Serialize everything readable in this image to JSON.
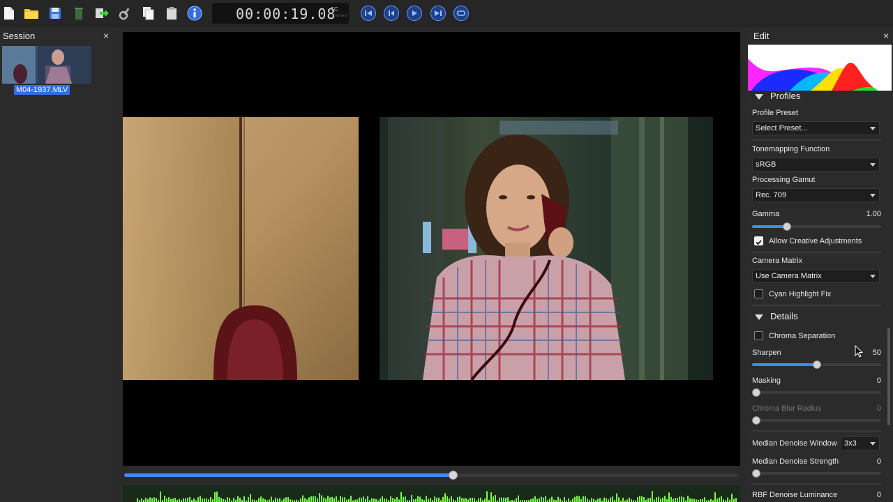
{
  "app": {
    "timecode": "00:00:19.08",
    "tc_label": "TC",
    "tc_sub": "(frames)"
  },
  "toolbar": {
    "icons": [
      "new-file-icon",
      "open-folder-icon",
      "save-icon",
      "trash-icon",
      "export-icon",
      "settings-icon",
      "copy-icon",
      "paste-icon",
      "info-icon"
    ],
    "nav_buttons": [
      "jump-start-icon",
      "step-back-icon",
      "play-icon",
      "jump-end-icon",
      "loop-icon"
    ]
  },
  "session": {
    "title": "Session",
    "close": "×",
    "clip_name": "M04-1937.MLV"
  },
  "viewer": {
    "playback_progress": 0.535
  },
  "edit": {
    "title": "Edit",
    "close": "×",
    "sections": {
      "profiles": "Profiles",
      "details": "Details"
    },
    "profile_preset": {
      "label": "Profile Preset",
      "value": "Select Preset..."
    },
    "tonemapping": {
      "label": "Tonemapping Function",
      "value": "sRGB"
    },
    "gamut": {
      "label": "Processing Gamut",
      "value": "Rec. 709"
    },
    "gamma": {
      "label": "Gamma",
      "value": "1.00",
      "fraction": 0.27
    },
    "allow_creative": {
      "label": "Allow Creative Adjustments",
      "checked": true
    },
    "camera_matrix": {
      "label": "Camera Matrix",
      "value": "Use Camera Matrix"
    },
    "cyan_fix": {
      "label": "Cyan Highlight Fix",
      "checked": false
    },
    "chroma_sep": {
      "label": "Chroma Separation",
      "checked": false
    },
    "sharpen": {
      "label": "Sharpen",
      "value": "50",
      "fraction": 0.5
    },
    "masking": {
      "label": "Masking",
      "value": "0",
      "fraction": 0
    },
    "chroma_blur": {
      "label": "Chroma Blur Radius",
      "value": "0",
      "fraction": 0
    },
    "median_window": {
      "label": "Median Denoise Window",
      "value": "3x3"
    },
    "median_strength": {
      "label": "Median Denoise Strength",
      "value": "0",
      "fraction": 0
    },
    "rbf_luminance": {
      "label": "RBF Denoise Luminance",
      "value": "0"
    }
  },
  "colors": {
    "accent": "#3d8bff",
    "selection": "#2f6fe0",
    "waveform": "#7cff4a"
  }
}
